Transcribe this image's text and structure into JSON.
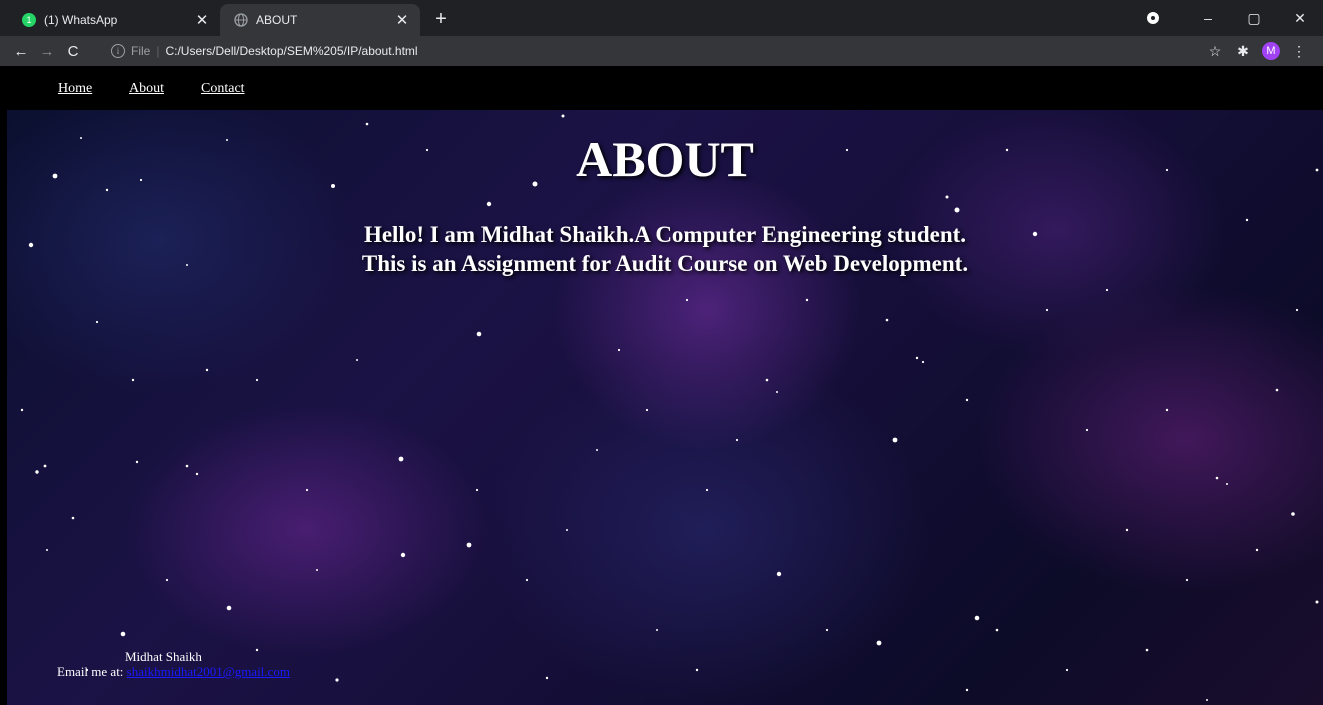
{
  "browser": {
    "tabs": [
      {
        "title": "(1) WhatsApp",
        "badge": "1"
      },
      {
        "title": "ABOUT"
      }
    ],
    "address": {
      "scheme": "File",
      "path": "C:/Users/Dell/Desktop/SEM%205/IP/about.html"
    },
    "profile_initial": "M"
  },
  "nav": {
    "items": [
      "Home",
      "About",
      "Contact"
    ]
  },
  "page": {
    "heading": "ABOUT",
    "intro_line1": "Hello! I am Midhat Shaikh.A Computer Engineering student.",
    "intro_line2": "This is an Assignment for Audit Course on Web Development."
  },
  "footer": {
    "name": "Midhat Shaikh",
    "email_prefix": "Email me at:",
    "email_link": "shaikhmidhat2001@gmail.com"
  },
  "colors": {
    "accent": "#a142f4",
    "link": "#1a1aff",
    "whatsapp": "#25d366"
  }
}
